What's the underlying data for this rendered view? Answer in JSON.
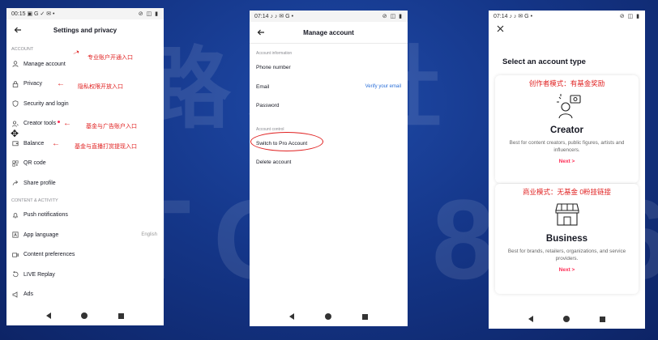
{
  "background": {
    "line1": "路新社",
    "line2": "TOK876"
  },
  "phone1": {
    "status_time": "00:15",
    "status_icons_left": "▣ G ✓ ✉ •",
    "status_icons_right": "⊘ ◫ ▮",
    "title": "Settings and privacy",
    "section_account": "ACCOUNT",
    "items": [
      {
        "label": "Manage account",
        "annot": "专业账户开通入口"
      },
      {
        "label": "Privacy",
        "annot": "隐私权限开放入口"
      },
      {
        "label": "Security and login",
        "annot": ""
      },
      {
        "label": "Creator tools",
        "annot": "基金与广告账户入口"
      },
      {
        "label": "Balance",
        "annot": "基金与直播打赏提现入口"
      },
      {
        "label": "QR code",
        "annot": ""
      },
      {
        "label": "Share profile",
        "annot": ""
      }
    ],
    "section_content": "CONTENT & ACTIVITY",
    "content_items": [
      {
        "label": "Push notifications",
        "right": ""
      },
      {
        "label": "App language",
        "right": "English"
      },
      {
        "label": "Content preferences",
        "right": ""
      },
      {
        "label": "LIVE Replay",
        "right": ""
      },
      {
        "label": "Ads",
        "right": ""
      }
    ]
  },
  "phone2": {
    "status_time": "07:14",
    "status_icons_left": "♪ ♪ ✉ G •",
    "status_icons_right": "⊘ ◫ ▮",
    "title": "Manage account",
    "section_info": "Account information",
    "info_items": [
      {
        "label": "Phone number",
        "link": ""
      },
      {
        "label": "Email",
        "link": "Verify your email"
      },
      {
        "label": "Password",
        "link": ""
      }
    ],
    "section_control": "Account control",
    "control_items": [
      {
        "label": "Switch to Pro Account"
      },
      {
        "label": "Delete account"
      }
    ]
  },
  "phone3": {
    "status_time": "07:14",
    "status_icons_left": "♪ ♪ ✉ G •",
    "status_icons_right": "⊘ ◫ ▮",
    "heading": "Select an account type",
    "creator": {
      "annot": "创作者模式：有基金奖励",
      "title": "Creator",
      "desc": "Best for content creators, public figures, artists and influencers.",
      "next": "Next >"
    },
    "business": {
      "annot": "商业模式：无基金 0粉挂链接",
      "title": "Business",
      "desc": "Best for brands, retailers, organizations, and service providers.",
      "next": "Next >"
    }
  },
  "colors": {
    "accent": "#fe2c55",
    "annotation": "#e02020",
    "link": "#2a6fd8",
    "background": "#15378a"
  }
}
